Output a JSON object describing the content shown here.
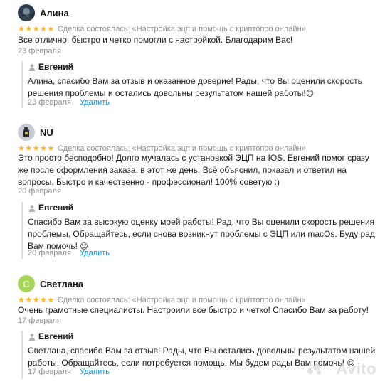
{
  "reviews": [
    {
      "author": "Алина",
      "stars": "★★★★★",
      "deal": "Сделка состоялась: «Настройка эцп и помощь с криптопро онлайн»",
      "text": "Все отлично, быстро и четко помогли с настройкой. Благодарим Вас!",
      "date": "23 февраля",
      "reply": {
        "author": "Евгений",
        "text": "Алина, спасибо Вам за отзыв и оказанное доверие! Рады, что Вы оценили скорость решения проблемы и остались довольны результатом нашей работы!",
        "date": "23 февраля",
        "delete": "Удалить"
      }
    },
    {
      "author": "NU",
      "stars": "★★★★★",
      "deal": "Сделка состоялась: «Настройка эцп и помощь с криптопро онлайн»",
      "text": "Это просто бесподобно! Долго мучалась с установкой ЭЦП на IOS. Евгений помог сразу же после оформления заказа, в этот же день. Всё объяснил, показал и ответил на вопросы. Быстро и качественно - профессионал! 100% советую :)",
      "date": "20 февраля",
      "reply": {
        "author": "Евгений",
        "text": "Спасибо Вам за высокую оценку моей работы! Рад, что Вы оценили скорость решения проблемы. Обращайтесь, если снова возникнут проблемы с ЭЦП или macOs. Буду рад Вам помочь!",
        "date": "20 февраля",
        "delete": "Удалить"
      }
    },
    {
      "author": "Светлана",
      "avatar_letter": "С",
      "stars": "★★★★★",
      "deal": "Сделка состоялась: «Настройка эцп и помощь с криптопро онлайн»",
      "text": "Очень грамотные специалисты. Настроили все быстро и четко! Спасибо Вам за работу!",
      "date": "17 февраля",
      "reply": {
        "author": "Евгений",
        "text": "Светлана, спасибо Вам за отзыв! Рады, что Вы остались довольны результатом нашей работы. Обращайтесь, если потребуется помощь. Мы будем рады Вам помочь!",
        "date": "17 февраля",
        "delete": "Удалить"
      }
    }
  ],
  "watermark": "Avito",
  "colors": {
    "star": "#ffb021",
    "link": "#0099f7",
    "muted": "#8f8f8f",
    "avatar_green": "#a5d65a"
  },
  "icons": {
    "emoji": "smiling-face-emoji",
    "reply": "person-icon"
  }
}
